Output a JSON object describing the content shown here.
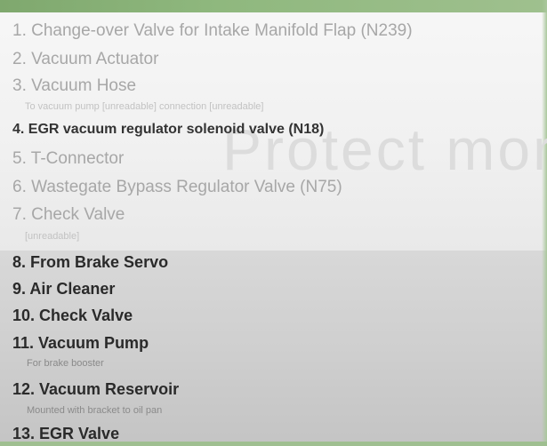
{
  "legend": {
    "items": [
      {
        "text": "1. Change-over Valve for Intake Manifold Flap (N239)"
      },
      {
        "text": "2. Vacuum Actuator"
      },
      {
        "text": "3. Vacuum Hose",
        "note": "To vacuum pump [unreadable] connection [unreadable]"
      },
      {
        "text": "4. EGR vacuum regulator solenoid valve (N18)"
      },
      {
        "text": "5. T-Connector"
      },
      {
        "text": "6. Wastegate Bypass Regulator Valve (N75)"
      },
      {
        "text": "7. Check Valve",
        "note": "[unreadable]"
      },
      {
        "text": "8. From Brake Servo"
      },
      {
        "text": "9. Air Cleaner"
      },
      {
        "text": "10. Check Valve"
      },
      {
        "text": "11. Vacuum Pump",
        "note": "For brake booster"
      },
      {
        "text": "12. Vacuum Reservoir",
        "note": "Mounted with bracket to oil pan"
      },
      {
        "text": "13. EGR Valve"
      }
    ]
  },
  "watermark": {
    "text": "Protect mor"
  },
  "colors": {
    "top_background": "#f4f4f4",
    "bottom_background": "#d2d2d2",
    "light_text": "#a7a7a7",
    "dark_text": "#2a2a2a",
    "accent_green": "#8fb87e"
  }
}
